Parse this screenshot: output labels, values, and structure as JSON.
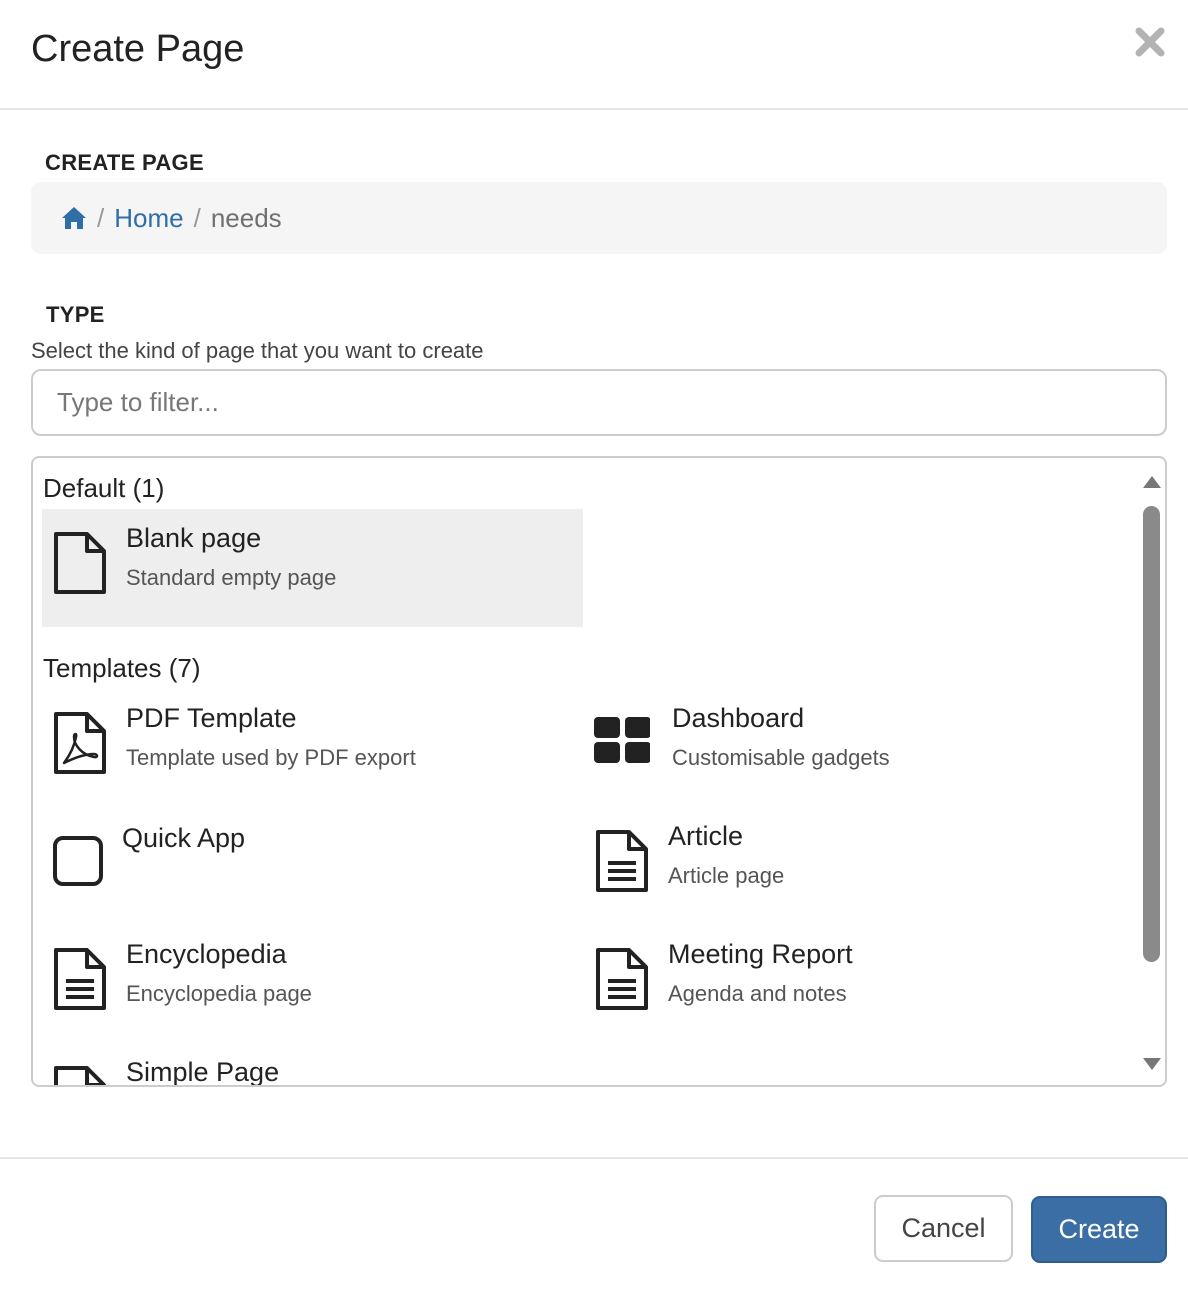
{
  "header": {
    "title": "Create Page",
    "close_icon": "close-icon"
  },
  "location": {
    "label": "CREATE PAGE",
    "breadcrumb": {
      "home_icon": "home-icon",
      "separator": "/",
      "items": [
        "Home",
        "needs"
      ]
    }
  },
  "type": {
    "label": "TYPE",
    "help": "Select the kind of page that you want to create",
    "filter_placeholder": "Type to filter...",
    "groups": [
      {
        "title": "Default (1)",
        "items": [
          {
            "name": "Blank page",
            "description": "Standard empty page",
            "icon": "blank-page-icon",
            "selected": true
          }
        ]
      },
      {
        "title": "Templates (7)",
        "items": [
          {
            "name": "PDF Template",
            "description": "Template used by PDF export",
            "icon": "pdf-file-icon"
          },
          {
            "name": "Dashboard",
            "description": "Customisable gadgets",
            "icon": "dashboard-grid-icon"
          },
          {
            "name": "Quick App",
            "description": "",
            "icon": "square-icon"
          },
          {
            "name": "Article",
            "description": "Article page",
            "icon": "text-file-icon"
          },
          {
            "name": "Encyclopedia",
            "description": "Encyclopedia page",
            "icon": "text-file-icon"
          },
          {
            "name": "Meeting Report",
            "description": "Agenda and notes",
            "icon": "text-file-icon"
          },
          {
            "name": "Simple Page",
            "description": "",
            "icon": "blank-page-icon"
          }
        ]
      }
    ]
  },
  "footer": {
    "cancel_label": "Cancel",
    "create_label": "Create"
  },
  "colors": {
    "primary": "#3b6ea5",
    "link": "#2f6ea7",
    "selected_bg": "#eeeeee"
  }
}
